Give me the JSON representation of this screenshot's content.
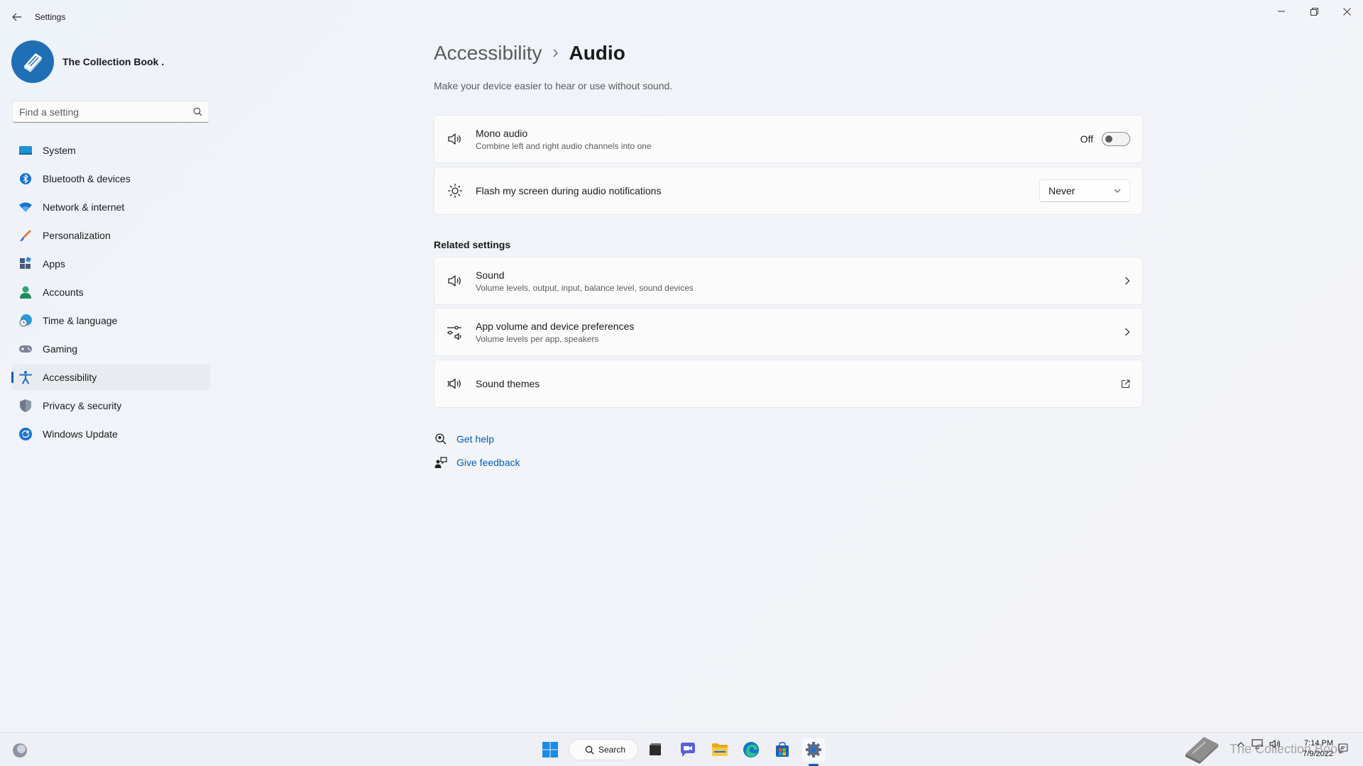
{
  "window": {
    "title": "Settings",
    "controls": {
      "minimize": "minimize-icon",
      "maximize": "restore-icon",
      "close": "close-icon"
    }
  },
  "profile": {
    "name": "The Collection Book ."
  },
  "search": {
    "placeholder": "Find a setting",
    "value": ""
  },
  "sidebar": {
    "items": [
      {
        "label": "System",
        "icon": "system-icon"
      },
      {
        "label": "Bluetooth & devices",
        "icon": "bluetooth-icon"
      },
      {
        "label": "Network & internet",
        "icon": "wifi-icon"
      },
      {
        "label": "Personalization",
        "icon": "brush-icon"
      },
      {
        "label": "Apps",
        "icon": "apps-icon"
      },
      {
        "label": "Accounts",
        "icon": "accounts-icon"
      },
      {
        "label": "Time & language",
        "icon": "globe-clock-icon"
      },
      {
        "label": "Gaming",
        "icon": "gamepad-icon"
      },
      {
        "label": "Accessibility",
        "icon": "accessibility-icon",
        "active": true
      },
      {
        "label": "Privacy & security",
        "icon": "shield-icon"
      },
      {
        "label": "Windows Update",
        "icon": "update-icon"
      }
    ]
  },
  "main": {
    "breadcrumb": {
      "parent": "Accessibility",
      "current": "Audio"
    },
    "description": "Make your device easier to hear or use without sound.",
    "settings": [
      {
        "title": "Mono audio",
        "subtitle": "Combine left and right audio channels into one",
        "control": "toggle",
        "state_label": "Off",
        "on": false
      },
      {
        "title": "Flash my screen during audio notifications",
        "control": "dropdown",
        "value": "Never"
      }
    ],
    "related_title": "Related settings",
    "related": [
      {
        "title": "Sound",
        "subtitle": "Volume levels, output, input, balance level, sound devices"
      },
      {
        "title": "App volume and device preferences",
        "subtitle": "Volume levels per app, speakers"
      },
      {
        "title": "Sound themes",
        "subtitle": ""
      }
    ],
    "help": {
      "get_help": "Get help",
      "give_feedback": "Give feedback"
    }
  },
  "taskbar": {
    "search_label": "Search",
    "watermark": "The Collection Book",
    "time": "7:14 PM",
    "date": "7/9/2022"
  },
  "colors": {
    "accent": "#005fb8",
    "background": "#f0f3f9",
    "card": "#fbfbfc"
  }
}
